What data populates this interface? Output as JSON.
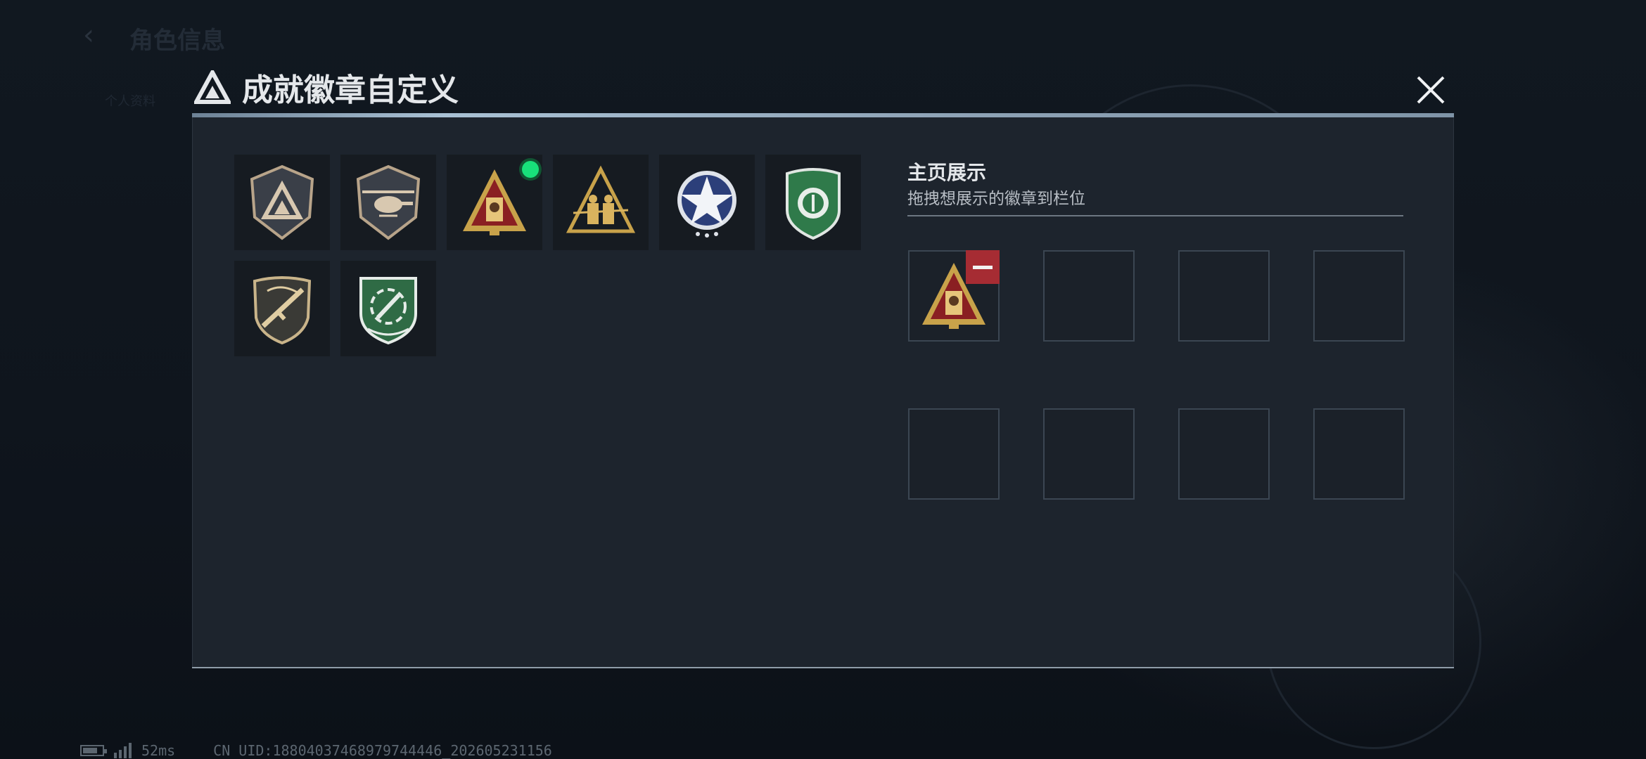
{
  "background": {
    "page_title": "角色信息",
    "nav_items": [
      "个人资料",
      "",
      "",
      "",
      "",
      ""
    ]
  },
  "modal": {
    "title": "成就徽章自定义",
    "badges": [
      {
        "icon": "triangle-shield-badge-icon",
        "new": false
      },
      {
        "icon": "helicopter-badge-icon",
        "new": false
      },
      {
        "icon": "red-triangle-badge-icon",
        "new": true
      },
      {
        "icon": "soldiers-triangle-badge-icon",
        "new": false
      },
      {
        "icon": "blue-star-badge-icon",
        "new": false
      },
      {
        "icon": "green-shield-badge-icon",
        "new": false
      },
      {
        "icon": "rifle-shield-badge-icon",
        "new": false
      },
      {
        "icon": "green-laurel-badge-icon",
        "new": false
      }
    ],
    "showcase": {
      "title": "主页展示",
      "subtitle": "拖拽想展示的徽章到栏位",
      "slots": [
        "red-triangle-badge-icon",
        "",
        "",
        "",
        "",
        "",
        "",
        ""
      ]
    }
  },
  "status": {
    "ping": "52ms",
    "uid": "CN UID:1880403746897974444​6_202605231156"
  },
  "colors": {
    "accent_remove": "#a62c33",
    "new_dot": "#18e07a",
    "modal_bg": "#1d242d"
  }
}
